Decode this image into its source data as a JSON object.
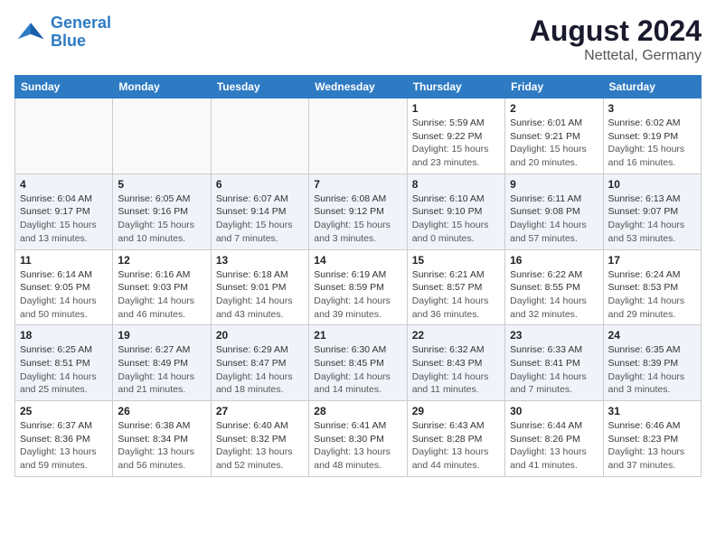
{
  "logo": {
    "line1": "General",
    "line2": "Blue"
  },
  "title": "August 2024",
  "location": "Nettetal, Germany",
  "days_header": [
    "Sunday",
    "Monday",
    "Tuesday",
    "Wednesday",
    "Thursday",
    "Friday",
    "Saturday"
  ],
  "weeks": [
    [
      {
        "day": "",
        "sunrise": "",
        "sunset": "",
        "daylight": ""
      },
      {
        "day": "",
        "sunrise": "",
        "sunset": "",
        "daylight": ""
      },
      {
        "day": "",
        "sunrise": "",
        "sunset": "",
        "daylight": ""
      },
      {
        "day": "",
        "sunrise": "",
        "sunset": "",
        "daylight": ""
      },
      {
        "day": "1",
        "sunrise": "5:59 AM",
        "sunset": "9:22 PM",
        "daylight": "15 hours and 23 minutes."
      },
      {
        "day": "2",
        "sunrise": "6:01 AM",
        "sunset": "9:21 PM",
        "daylight": "15 hours and 20 minutes."
      },
      {
        "day": "3",
        "sunrise": "6:02 AM",
        "sunset": "9:19 PM",
        "daylight": "15 hours and 16 minutes."
      }
    ],
    [
      {
        "day": "4",
        "sunrise": "6:04 AM",
        "sunset": "9:17 PM",
        "daylight": "15 hours and 13 minutes."
      },
      {
        "day": "5",
        "sunrise": "6:05 AM",
        "sunset": "9:16 PM",
        "daylight": "15 hours and 10 minutes."
      },
      {
        "day": "6",
        "sunrise": "6:07 AM",
        "sunset": "9:14 PM",
        "daylight": "15 hours and 7 minutes."
      },
      {
        "day": "7",
        "sunrise": "6:08 AM",
        "sunset": "9:12 PM",
        "daylight": "15 hours and 3 minutes."
      },
      {
        "day": "8",
        "sunrise": "6:10 AM",
        "sunset": "9:10 PM",
        "daylight": "15 hours and 0 minutes."
      },
      {
        "day": "9",
        "sunrise": "6:11 AM",
        "sunset": "9:08 PM",
        "daylight": "14 hours and 57 minutes."
      },
      {
        "day": "10",
        "sunrise": "6:13 AM",
        "sunset": "9:07 PM",
        "daylight": "14 hours and 53 minutes."
      }
    ],
    [
      {
        "day": "11",
        "sunrise": "6:14 AM",
        "sunset": "9:05 PM",
        "daylight": "14 hours and 50 minutes."
      },
      {
        "day": "12",
        "sunrise": "6:16 AM",
        "sunset": "9:03 PM",
        "daylight": "14 hours and 46 minutes."
      },
      {
        "day": "13",
        "sunrise": "6:18 AM",
        "sunset": "9:01 PM",
        "daylight": "14 hours and 43 minutes."
      },
      {
        "day": "14",
        "sunrise": "6:19 AM",
        "sunset": "8:59 PM",
        "daylight": "14 hours and 39 minutes."
      },
      {
        "day": "15",
        "sunrise": "6:21 AM",
        "sunset": "8:57 PM",
        "daylight": "14 hours and 36 minutes."
      },
      {
        "day": "16",
        "sunrise": "6:22 AM",
        "sunset": "8:55 PM",
        "daylight": "14 hours and 32 minutes."
      },
      {
        "day": "17",
        "sunrise": "6:24 AM",
        "sunset": "8:53 PM",
        "daylight": "14 hours and 29 minutes."
      }
    ],
    [
      {
        "day": "18",
        "sunrise": "6:25 AM",
        "sunset": "8:51 PM",
        "daylight": "14 hours and 25 minutes."
      },
      {
        "day": "19",
        "sunrise": "6:27 AM",
        "sunset": "8:49 PM",
        "daylight": "14 hours and 21 minutes."
      },
      {
        "day": "20",
        "sunrise": "6:29 AM",
        "sunset": "8:47 PM",
        "daylight": "14 hours and 18 minutes."
      },
      {
        "day": "21",
        "sunrise": "6:30 AM",
        "sunset": "8:45 PM",
        "daylight": "14 hours and 14 minutes."
      },
      {
        "day": "22",
        "sunrise": "6:32 AM",
        "sunset": "8:43 PM",
        "daylight": "14 hours and 11 minutes."
      },
      {
        "day": "23",
        "sunrise": "6:33 AM",
        "sunset": "8:41 PM",
        "daylight": "14 hours and 7 minutes."
      },
      {
        "day": "24",
        "sunrise": "6:35 AM",
        "sunset": "8:39 PM",
        "daylight": "14 hours and 3 minutes."
      }
    ],
    [
      {
        "day": "25",
        "sunrise": "6:37 AM",
        "sunset": "8:36 PM",
        "daylight": "13 hours and 59 minutes."
      },
      {
        "day": "26",
        "sunrise": "6:38 AM",
        "sunset": "8:34 PM",
        "daylight": "13 hours and 56 minutes."
      },
      {
        "day": "27",
        "sunrise": "6:40 AM",
        "sunset": "8:32 PM",
        "daylight": "13 hours and 52 minutes."
      },
      {
        "day": "28",
        "sunrise": "6:41 AM",
        "sunset": "8:30 PM",
        "daylight": "13 hours and 48 minutes."
      },
      {
        "day": "29",
        "sunrise": "6:43 AM",
        "sunset": "8:28 PM",
        "daylight": "13 hours and 44 minutes."
      },
      {
        "day": "30",
        "sunrise": "6:44 AM",
        "sunset": "8:26 PM",
        "daylight": "13 hours and 41 minutes."
      },
      {
        "day": "31",
        "sunrise": "6:46 AM",
        "sunset": "8:23 PM",
        "daylight": "13 hours and 37 minutes."
      }
    ]
  ]
}
